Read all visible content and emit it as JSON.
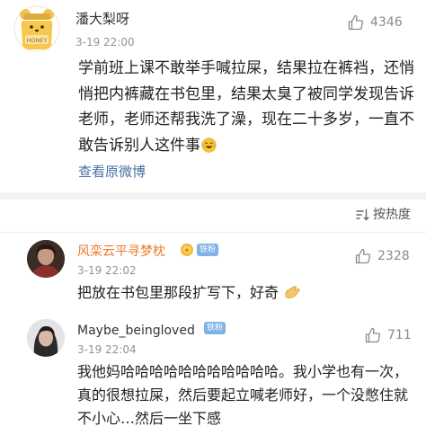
{
  "post": {
    "username": "潘大梨呀",
    "timestamp": "3-19 22:00",
    "like_count": "4346",
    "avatar_icon": "honey-jar-bear-avatar",
    "avatar_text": "HONEY",
    "body": "学前班上课不敢举手喊拉屎，结果拉在裤裆，还悄悄把内裤藏在书包里，结果太臭了被同学发现告诉老师，老师还帮我洗了澡，现在二十多岁，一直不敢告诉别人这件事",
    "body_emoji": "laugh-cry-emoji",
    "view_original": "查看原微博"
  },
  "sort": {
    "label": "按热度",
    "icon": "sort-icon"
  },
  "comments": [
    {
      "username": "风栾云平寻梦枕",
      "username_color": "#e87a2d",
      "badge": "铁粉",
      "badge_medal_icon": "fan-medal-icon",
      "timestamp": "3-19 22:02",
      "like_count": "2328",
      "body": "把放在书包里那段扩写下，好奇",
      "body_emoji": "pinching-hand-emoji"
    },
    {
      "username": "Maybe_beingloved",
      "username_color": "#333333",
      "badge": "铁粉",
      "timestamp": "3-19 22:04",
      "like_count": "711",
      "body": "我他妈哈哈哈哈哈哈哈哈哈哈哈。我小学也有一次，真的很想拉屎，然后要起立喊老师好，一个没憋住就不小心…然后一坐下感"
    }
  ],
  "colors": {
    "link": "#4a6fa5",
    "badge_bg": "#7fb2e5",
    "separator": "#f2f2f2"
  }
}
